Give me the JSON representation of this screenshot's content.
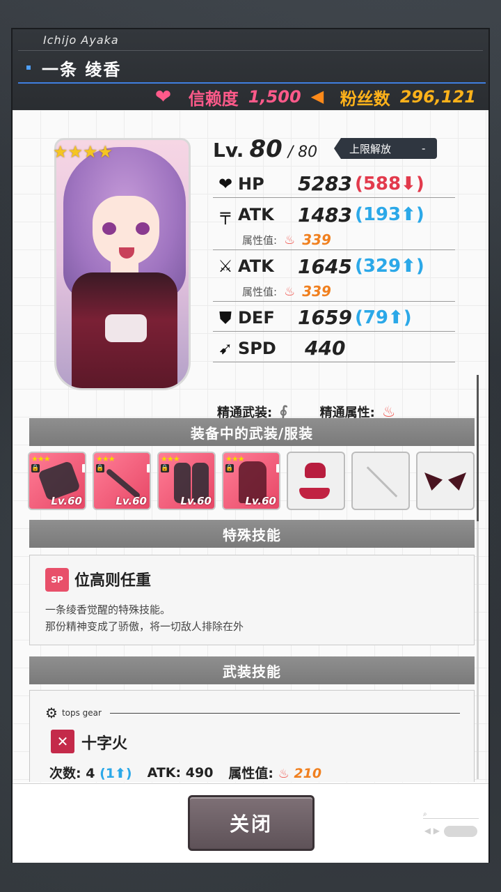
{
  "header": {
    "romaji": "Ichijo Ayaka",
    "name": "一条 绫香",
    "trust_label": "信赖度",
    "trust_value": "1,500",
    "fans_label": "粉丝数",
    "fans_value": "296,121"
  },
  "character": {
    "rarity_stars": 4,
    "stars_text": "★★★★",
    "level_label": "Lv.",
    "level": "80",
    "level_max": "/ 80",
    "limit_break": "上限解放",
    "limit_break_dash": "-",
    "stats": [
      {
        "icon": "heart-icon",
        "glyph": "❤",
        "name": "HP",
        "value": "5283",
        "diff": "(588⬇)",
        "diff_dir": "down"
      },
      {
        "icon": "gun-icon",
        "glyph": "╤",
        "name": "ATK",
        "value": "1483",
        "diff": "(193⬆)",
        "diff_dir": "up"
      },
      {
        "icon": "sword-icon",
        "glyph": "⚔",
        "name": "ATK",
        "value": "1645",
        "diff": "(329⬆)",
        "diff_dir": "up"
      },
      {
        "icon": "shield-icon",
        "glyph": "⛊",
        "name": "DEF",
        "value": "1659",
        "diff": "(79⬆)",
        "diff_dir": "up"
      },
      {
        "icon": "wing-icon",
        "glyph": "➹",
        "name": "SPD",
        "value": "440",
        "diff": "",
        "diff_dir": "none"
      }
    ],
    "attr_rows": [
      {
        "label": "属性值:",
        "value": "339"
      },
      {
        "label": "属性值:",
        "value": "339"
      }
    ],
    "mastery_weapon_label": "精通武装:",
    "mastery_attr_label": "精通属性:"
  },
  "sections": {
    "equipped": "装备中的武装/服装",
    "special_skill": "特殊技能",
    "weapon_skill": "武装技能"
  },
  "equipment": [
    {
      "type": "gear",
      "stars": "★★★",
      "level": "Lv.60"
    },
    {
      "type": "gear",
      "stars": "★★★",
      "level": "Lv.60"
    },
    {
      "type": "gear",
      "stars": "★★★",
      "level": "Lv.60"
    },
    {
      "type": "gear",
      "stars": "★★★",
      "level": "Lv.60"
    },
    {
      "type": "costume-top"
    },
    {
      "type": "empty"
    },
    {
      "type": "costume-ears"
    }
  ],
  "special_skill": {
    "icon_text": "SP",
    "title": "位高则任重",
    "desc_line1": "一条绫香觉醒的特殊技能。",
    "desc_line2": "那份精神变成了骄傲，将一切敌人排除在外"
  },
  "weapon_skill": {
    "slot_label": "tops gear",
    "title": "十字火",
    "count_label": "次数:",
    "count_value": "4",
    "count_bonus": "(1⬆)",
    "atk_label": "ATK:",
    "atk_value": "490",
    "attr_label": "属性值:",
    "attr_value": "210"
  },
  "footer": {
    "close_label": "关闭"
  },
  "colors": {
    "trust": "#ff5a8a",
    "fans": "#ffb21a",
    "diff_down": "#e23a4c",
    "diff_up": "#2ba8e8",
    "attr": "#f08020",
    "gear_bg": "#e74766"
  }
}
